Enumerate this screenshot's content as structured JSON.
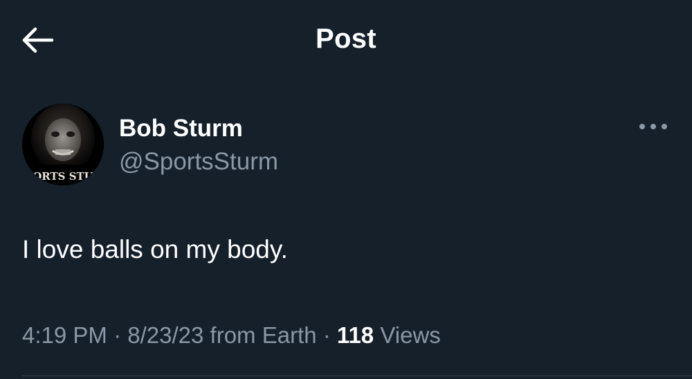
{
  "header": {
    "back_icon": "arrow-left-icon",
    "title": "Post"
  },
  "author": {
    "display_name": "Bob Sturm",
    "handle": "@SportsSturm",
    "avatar_text": "ORTS STU"
  },
  "more_icon": "more-horizontal-icon",
  "tweet": {
    "text": "I love balls on my body."
  },
  "meta": {
    "time": "4:19 PM",
    "separator": "·",
    "date": "8/23/23",
    "source": "from Earth",
    "views_count": "118",
    "views_label": "Views"
  },
  "colors": {
    "background": "#15202b",
    "primary_text": "#ffffff",
    "secondary_text": "#8b98a5",
    "divider": "#38444d"
  }
}
